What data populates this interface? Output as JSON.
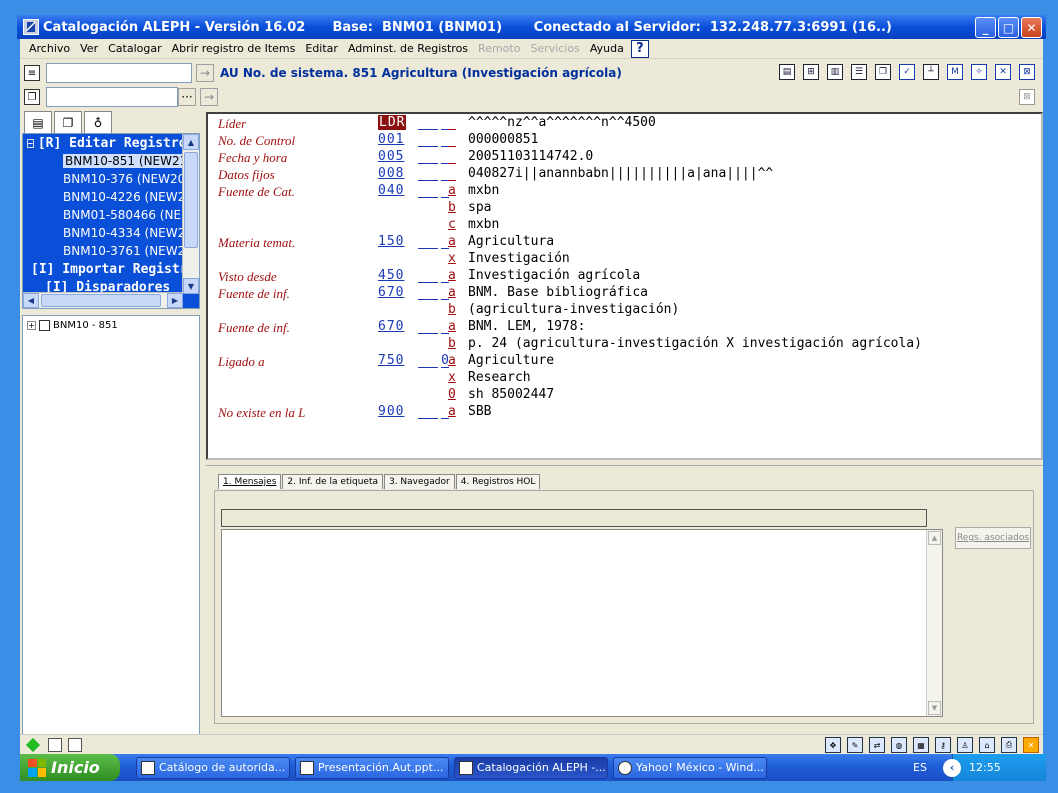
{
  "window": {
    "title": "Catalogación ALEPH - Versión 16.02      Base:  BNM01 (BNM01)       Conectado al Servidor:  132.248.77.3:6991 (16..)",
    "buttons": {
      "minimize": "_",
      "maximize": "□",
      "close": "✕"
    }
  },
  "menu": {
    "items": [
      {
        "label": "Archivo",
        "enabled": true
      },
      {
        "label": "Ver",
        "enabled": true
      },
      {
        "label": "Catalogar",
        "enabled": true
      },
      {
        "label": "Abrir registro de Items",
        "enabled": true
      },
      {
        "label": "Editar",
        "enabled": true
      },
      {
        "label": "Adminst. de Registros",
        "enabled": true
      },
      {
        "label": "Remoto",
        "enabled": false
      },
      {
        "label": "Servicios",
        "enabled": false
      },
      {
        "label": "Ayuda",
        "enabled": true
      }
    ],
    "help_icon": "?"
  },
  "toolbar": {
    "record_title": "AU No. de sistema. 851 Agricultura (Investigación agrícola)",
    "search_input_1": "",
    "search_input_2": "",
    "more_button": "···",
    "arrow": "→"
  },
  "left_panel": {
    "tree": [
      {
        "label": "[R] Editar Registros",
        "type": "head",
        "expander": "−"
      },
      {
        "label": "BNM10-851 (NEW21",
        "type": "item",
        "selected": true
      },
      {
        "label": "BNM10-376 (NEW20",
        "type": "item"
      },
      {
        "label": "BNM10-4226 (NEW2",
        "type": "item"
      },
      {
        "label": "BNM01-580466 (NE",
        "type": "item"
      },
      {
        "label": "BNM10-4334 (NEW2",
        "type": "item"
      },
      {
        "label": "BNM10-3761 (NEW2",
        "type": "item"
      },
      {
        "label": "[I] Importar Registr",
        "type": "head"
      },
      {
        "label": "[I] Disparadores",
        "type": "head"
      }
    ],
    "tree2_label": "BNM10 - 851",
    "tree2_expander": "+"
  },
  "record": {
    "fields": [
      {
        "label": "Líder",
        "tag": "LDR",
        "ind1": "",
        "ind2": "",
        "sub": "",
        "value": "^^^^^nz^^a^^^^^^^n^^4500"
      },
      {
        "label": "No. de Control",
        "tag": "001",
        "ind1": "",
        "ind2": "",
        "sub": "",
        "value": "000000851"
      },
      {
        "label": "Fecha y hora",
        "tag": "005",
        "ind1": "",
        "ind2": "",
        "sub": "",
        "value": "20051103114742.0"
      },
      {
        "label": "Datos fijos",
        "tag": "008",
        "ind1": "",
        "ind2": "",
        "sub": "",
        "value": "040827i||anannbabn||||||||||a|ana||||^^"
      },
      {
        "label": "Fuente de Cat.",
        "tag": "040",
        "ind1": "",
        "ind2": "",
        "sub": "a",
        "value": "mxbn"
      },
      {
        "label": "",
        "tag": "",
        "ind1": "",
        "ind2": "",
        "sub": "b",
        "value": "spa"
      },
      {
        "label": "",
        "tag": "",
        "ind1": "",
        "ind2": "",
        "sub": "c",
        "value": "mxbn"
      },
      {
        "label": "Materia temat.",
        "tag": "150",
        "ind1": "",
        "ind2": "",
        "sub": "a",
        "value": "Agricultura"
      },
      {
        "label": "",
        "tag": "",
        "ind1": "",
        "ind2": "",
        "sub": "x",
        "value": "Investigación"
      },
      {
        "label": "Visto desde",
        "tag": "450",
        "ind1": "",
        "ind2": "",
        "sub": "a",
        "value": "Investigación agrícola"
      },
      {
        "label": "Fuente de inf.",
        "tag": "670",
        "ind1": "",
        "ind2": "",
        "sub": "a",
        "value": "BNM. Base bibliográfica"
      },
      {
        "label": "",
        "tag": "",
        "ind1": "",
        "ind2": "",
        "sub": "b",
        "value": "(agricultura-investigación)"
      },
      {
        "label": "Fuente de inf.",
        "tag": "670",
        "ind1": "",
        "ind2": "",
        "sub": "a",
        "value": "BNM. LEM, 1978:"
      },
      {
        "label": "",
        "tag": "",
        "ind1": "",
        "ind2": "",
        "sub": "b",
        "value": "p. 24 (agricultura-investigación X investigación agrícola)"
      },
      {
        "label": "Ligado a",
        "tag": "750",
        "ind1": "",
        "ind2": "0",
        "sub": "a",
        "value": "Agriculture"
      },
      {
        "label": "",
        "tag": "",
        "ind1": "",
        "ind2": "",
        "sub": "x",
        "value": "Research"
      },
      {
        "label": "",
        "tag": "",
        "ind1": "",
        "ind2": "",
        "sub": "0",
        "value": "sh 85002447"
      },
      {
        "label": "No existe en la L",
        "tag": "900",
        "ind1": "",
        "ind2": "",
        "sub": "a",
        "value": "SBB"
      }
    ]
  },
  "bottom": {
    "tabs": [
      "1. Mensajes",
      "2. Inf. de la etiqueta",
      "3. Navegador",
      "4. Registros HOL"
    ],
    "regs_button": "Regs. asociados"
  },
  "taskbar": {
    "start": "Inicio",
    "tasks": [
      {
        "label": "Catálogo de autorida...",
        "active": false
      },
      {
        "label": "Presentación.Aut.ppt...",
        "active": false
      },
      {
        "label": "Catalogación ALEPH -...",
        "active": true
      },
      {
        "label": "Yahoo! México - Wind...",
        "active": false
      }
    ],
    "lang": "ES",
    "tray_arrow": "‹",
    "clock": "12:55"
  },
  "colors": {
    "title_blue": "#0a4fd8",
    "field_label_red": "#a01010",
    "tag_blue": "#1a3ab8",
    "desktop": "#3a8ee6"
  }
}
